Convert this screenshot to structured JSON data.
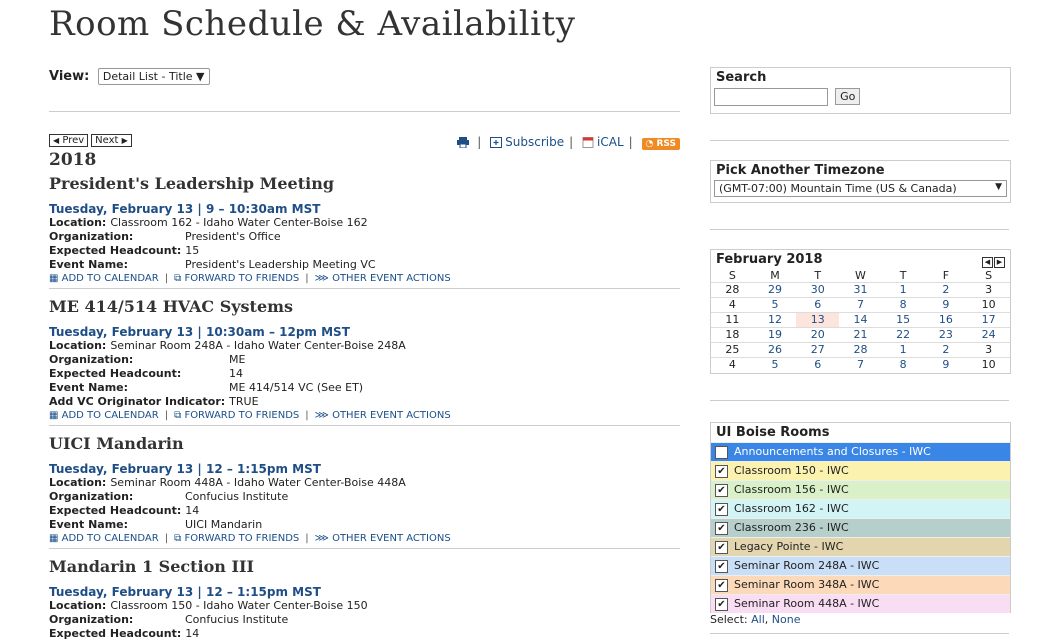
{
  "page": {
    "title": "Room Schedule & Availability"
  },
  "view": {
    "label": "View:",
    "selected": "Detail List - Title"
  },
  "nav": {
    "prev": "Prev",
    "next": "Next"
  },
  "feeds": {
    "subscribe": "Subscribe",
    "ical": "iCAL",
    "rss": "RSS"
  },
  "year": "2018",
  "events": [
    {
      "title": "President's Leadership Meeting",
      "date": "Tuesday, February 13 | 9 – 10:30am MST",
      "fields": [
        {
          "k": "Location:",
          "v": "Classroom 162 - Idaho Water Center-Boise 162"
        },
        {
          "k": "Organization:",
          "v": "President's Office"
        },
        {
          "k": "Expected Headcount:",
          "v": "15"
        },
        {
          "k": "Event Name:",
          "v": "President's Leadership Meeting VC"
        }
      ]
    },
    {
      "title": "ME 414/514 HVAC Systems",
      "date": "Tuesday, February 13 | 10:30am – 12pm MST",
      "fields": [
        {
          "k": "Location:",
          "v": "Seminar Room 248A - Idaho Water Center-Boise 248A"
        },
        {
          "k": "Organization:",
          "v": "ME"
        },
        {
          "k": "Expected Headcount:",
          "v": "14"
        },
        {
          "k": "Event Name:",
          "v": "ME 414/514 VC (See ET)"
        },
        {
          "k": "Add VC Originator Indicator:",
          "v": "TRUE"
        }
      ]
    },
    {
      "title": "UICI Mandarin",
      "date": "Tuesday, February 13 | 12 – 1:15pm MST",
      "fields": [
        {
          "k": "Location:",
          "v": "Seminar Room 448A - Idaho Water Center-Boise 448A"
        },
        {
          "k": "Organization:",
          "v": "Confucius Institute"
        },
        {
          "k": "Expected Headcount:",
          "v": "14"
        },
        {
          "k": "Event Name:",
          "v": "UICI Mandarin"
        }
      ]
    },
    {
      "title": "Mandarin 1 Section III",
      "date": "Tuesday, February 13 | 12 – 1:15pm MST",
      "fields": [
        {
          "k": "Location:",
          "v": "Classroom 150 - Idaho Water Center-Boise 150"
        },
        {
          "k": "Organization:",
          "v": "Confucius Institute"
        },
        {
          "k": "Expected Headcount:",
          "v": "14"
        }
      ]
    }
  ],
  "actions": {
    "add": "ADD TO CALENDAR",
    "forward": "FORWARD TO FRIENDS",
    "other": "OTHER EVENT ACTIONS"
  },
  "search": {
    "title": "Search",
    "go": "Go"
  },
  "timezone": {
    "title": "Pick Another Timezone",
    "selected": "(GMT-07:00) Mountain Time (US & Canada)"
  },
  "calendar": {
    "title": "February 2018",
    "days": [
      "S",
      "M",
      "T",
      "W",
      "T",
      "F",
      "S"
    ],
    "weeks": [
      [
        "28",
        "29",
        "30",
        "31",
        "1",
        "2",
        "3"
      ],
      [
        "4",
        "5",
        "6",
        "7",
        "8",
        "9",
        "10"
      ],
      [
        "11",
        "12",
        "13",
        "14",
        "15",
        "16",
        "17"
      ],
      [
        "18",
        "19",
        "20",
        "21",
        "22",
        "23",
        "24"
      ],
      [
        "25",
        "26",
        "27",
        "28",
        "1",
        "2",
        "3"
      ],
      [
        "4",
        "5",
        "6",
        "7",
        "8",
        "9",
        "10"
      ]
    ],
    "today": "13"
  },
  "rooms": {
    "title": "UI Boise Rooms",
    "items": [
      {
        "label": "Announcements and Closures - IWC",
        "color": "#3a86e6"
      },
      {
        "label": "Classroom 150 - IWC",
        "color": "#fbf2b0"
      },
      {
        "label": "Classroom 156 - IWC",
        "color": "#d9f0c8"
      },
      {
        "label": "Classroom 162 - IWC",
        "color": "#d2f4f4"
      },
      {
        "label": "Classroom 236 - IWC",
        "color": "#b7cfca"
      },
      {
        "label": "Legacy Pointe - IWC",
        "color": "#e3d6ae"
      },
      {
        "label": "Seminar Room 248A - IWC",
        "color": "#c9def7"
      },
      {
        "label": "Seminar Room 348A - IWC",
        "color": "#fcd9b8"
      },
      {
        "label": "Seminar Room 448A - IWC",
        "color": "#f8ddf3"
      }
    ]
  },
  "select": {
    "label": "Select:",
    "all": "All",
    "none": "None"
  }
}
